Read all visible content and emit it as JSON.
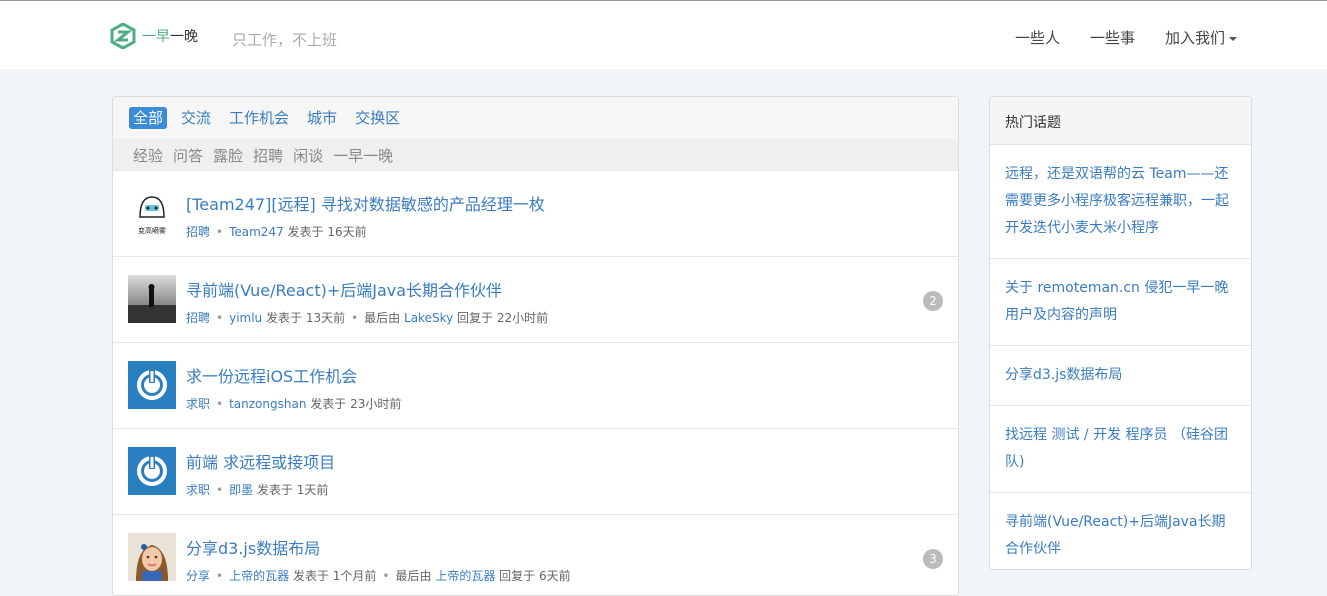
{
  "header": {
    "brand": {
      "part1": "一早",
      "part2": "一晚"
    },
    "slogan": "只工作，不上班",
    "icon_glyph": "",
    "nav": [
      "一些人",
      "一些事"
    ],
    "dropdown_label": "加入我们"
  },
  "tabs": [
    {
      "label": "全部",
      "active": true
    },
    {
      "label": "交流"
    },
    {
      "label": "工作机会"
    },
    {
      "label": "城市"
    },
    {
      "label": "交换区"
    }
  ],
  "subtabs": [
    "经验",
    "问答",
    "露脸",
    "招聘",
    "闲谈",
    "一早一晚"
  ],
  "topics": [
    {
      "title": "[Team247][远程] 寻找对数据敏感的产品经理一枚",
      "ext": "",
      "avatar_text": "变高嗬雾",
      "category": "招聘",
      "author": "Team247",
      "posted": "发表于 16天前"
    },
    {
      "title": "寻前端(Vue/React)+后端Java长期合作伙伴",
      "category": "招聘",
      "author": "yimlu",
      "posted": "发表于 13天前",
      "last_prefix": "最后由",
      "last_user": "LakeSky",
      "last_time": "回复于 22小时前",
      "replies": "2"
    },
    {
      "title": "求一份远程iOS工作机会",
      "category": "求职",
      "author": "tanzongshan",
      "posted": "发表于 23小时前"
    },
    {
      "title": "前端 求远程或接项目",
      "category": "求职",
      "author": "即墨",
      "posted": "发表于 1天前"
    },
    {
      "title": "分享d3.js数据布局",
      "category": "分享",
      "author": "上帝的瓦器",
      "posted": "发表于 1个月前",
      "last_prefix": "最后由",
      "last_user": "上帝的瓦器",
      "last_time": "回复于 6天前",
      "replies": "3"
    }
  ],
  "sidebar": {
    "title": "热门话题",
    "items": [
      "远程，还是双语帮的云 Team——还需要更多小程序极客远程兼职，一起开发迭代小麦大米小程序",
      "关于 remoteman.cn 侵犯一早一晚用户及内容的声明",
      "分享d3.js数据布局",
      "找远程 测试 / 开发 程序员 （硅谷团队)",
      "寻前端(Vue/React)+后端Java长期合作伙伴"
    ]
  },
  "colors": {
    "link": "#3a7cc2",
    "active_tab": "#3a8bd8",
    "brand_green": "#4caf7f",
    "page_bg": "#f1f5f9"
  }
}
